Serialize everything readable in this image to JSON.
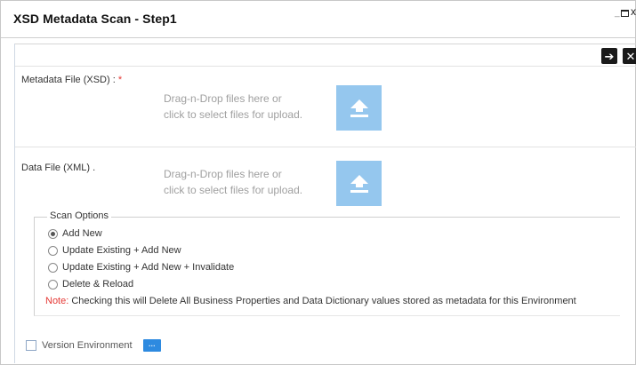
{
  "dialog": {
    "title": "XSD Metadata Scan - Step1",
    "window_minimize_glyph": "_",
    "window_maximize_glyph": "",
    "window_close_glyph": "x"
  },
  "toolbar": {
    "next_icon": "arrow-right-icon",
    "next_glyph": "➔",
    "close_icon": "close-icon",
    "close_glyph": "✕"
  },
  "metadata_file": {
    "label": "Metadata File (XSD) :",
    "required_mark": "*",
    "drop_line1": "Drag-n-Drop files here or",
    "drop_line2": "click to select files for upload."
  },
  "data_file": {
    "label": "Data File (XML) .",
    "drop_line1": "Drag-n-Drop files here or",
    "drop_line2": "click to select files for upload."
  },
  "scan_options": {
    "legend": "Scan Options",
    "options": [
      {
        "label": "Add New",
        "selected": true
      },
      {
        "label": "Update Existing + Add New",
        "selected": false
      },
      {
        "label": "Update Existing + Add New + Invalidate",
        "selected": false
      },
      {
        "label": "Delete & Reload",
        "selected": false
      }
    ],
    "note_label": "Note:",
    "note_text": " Checking this will Delete All Business Properties and Data Dictionary values stored as metadata for this Environment"
  },
  "version_environment": {
    "label": "Version Environment",
    "checked": false,
    "ellipsis": "..."
  },
  "colors": {
    "upload_button": "#95c7ee",
    "ellipsis_button": "#2d8ae0",
    "required": "#e53935",
    "toolbar_button": "#1a1a1a"
  }
}
